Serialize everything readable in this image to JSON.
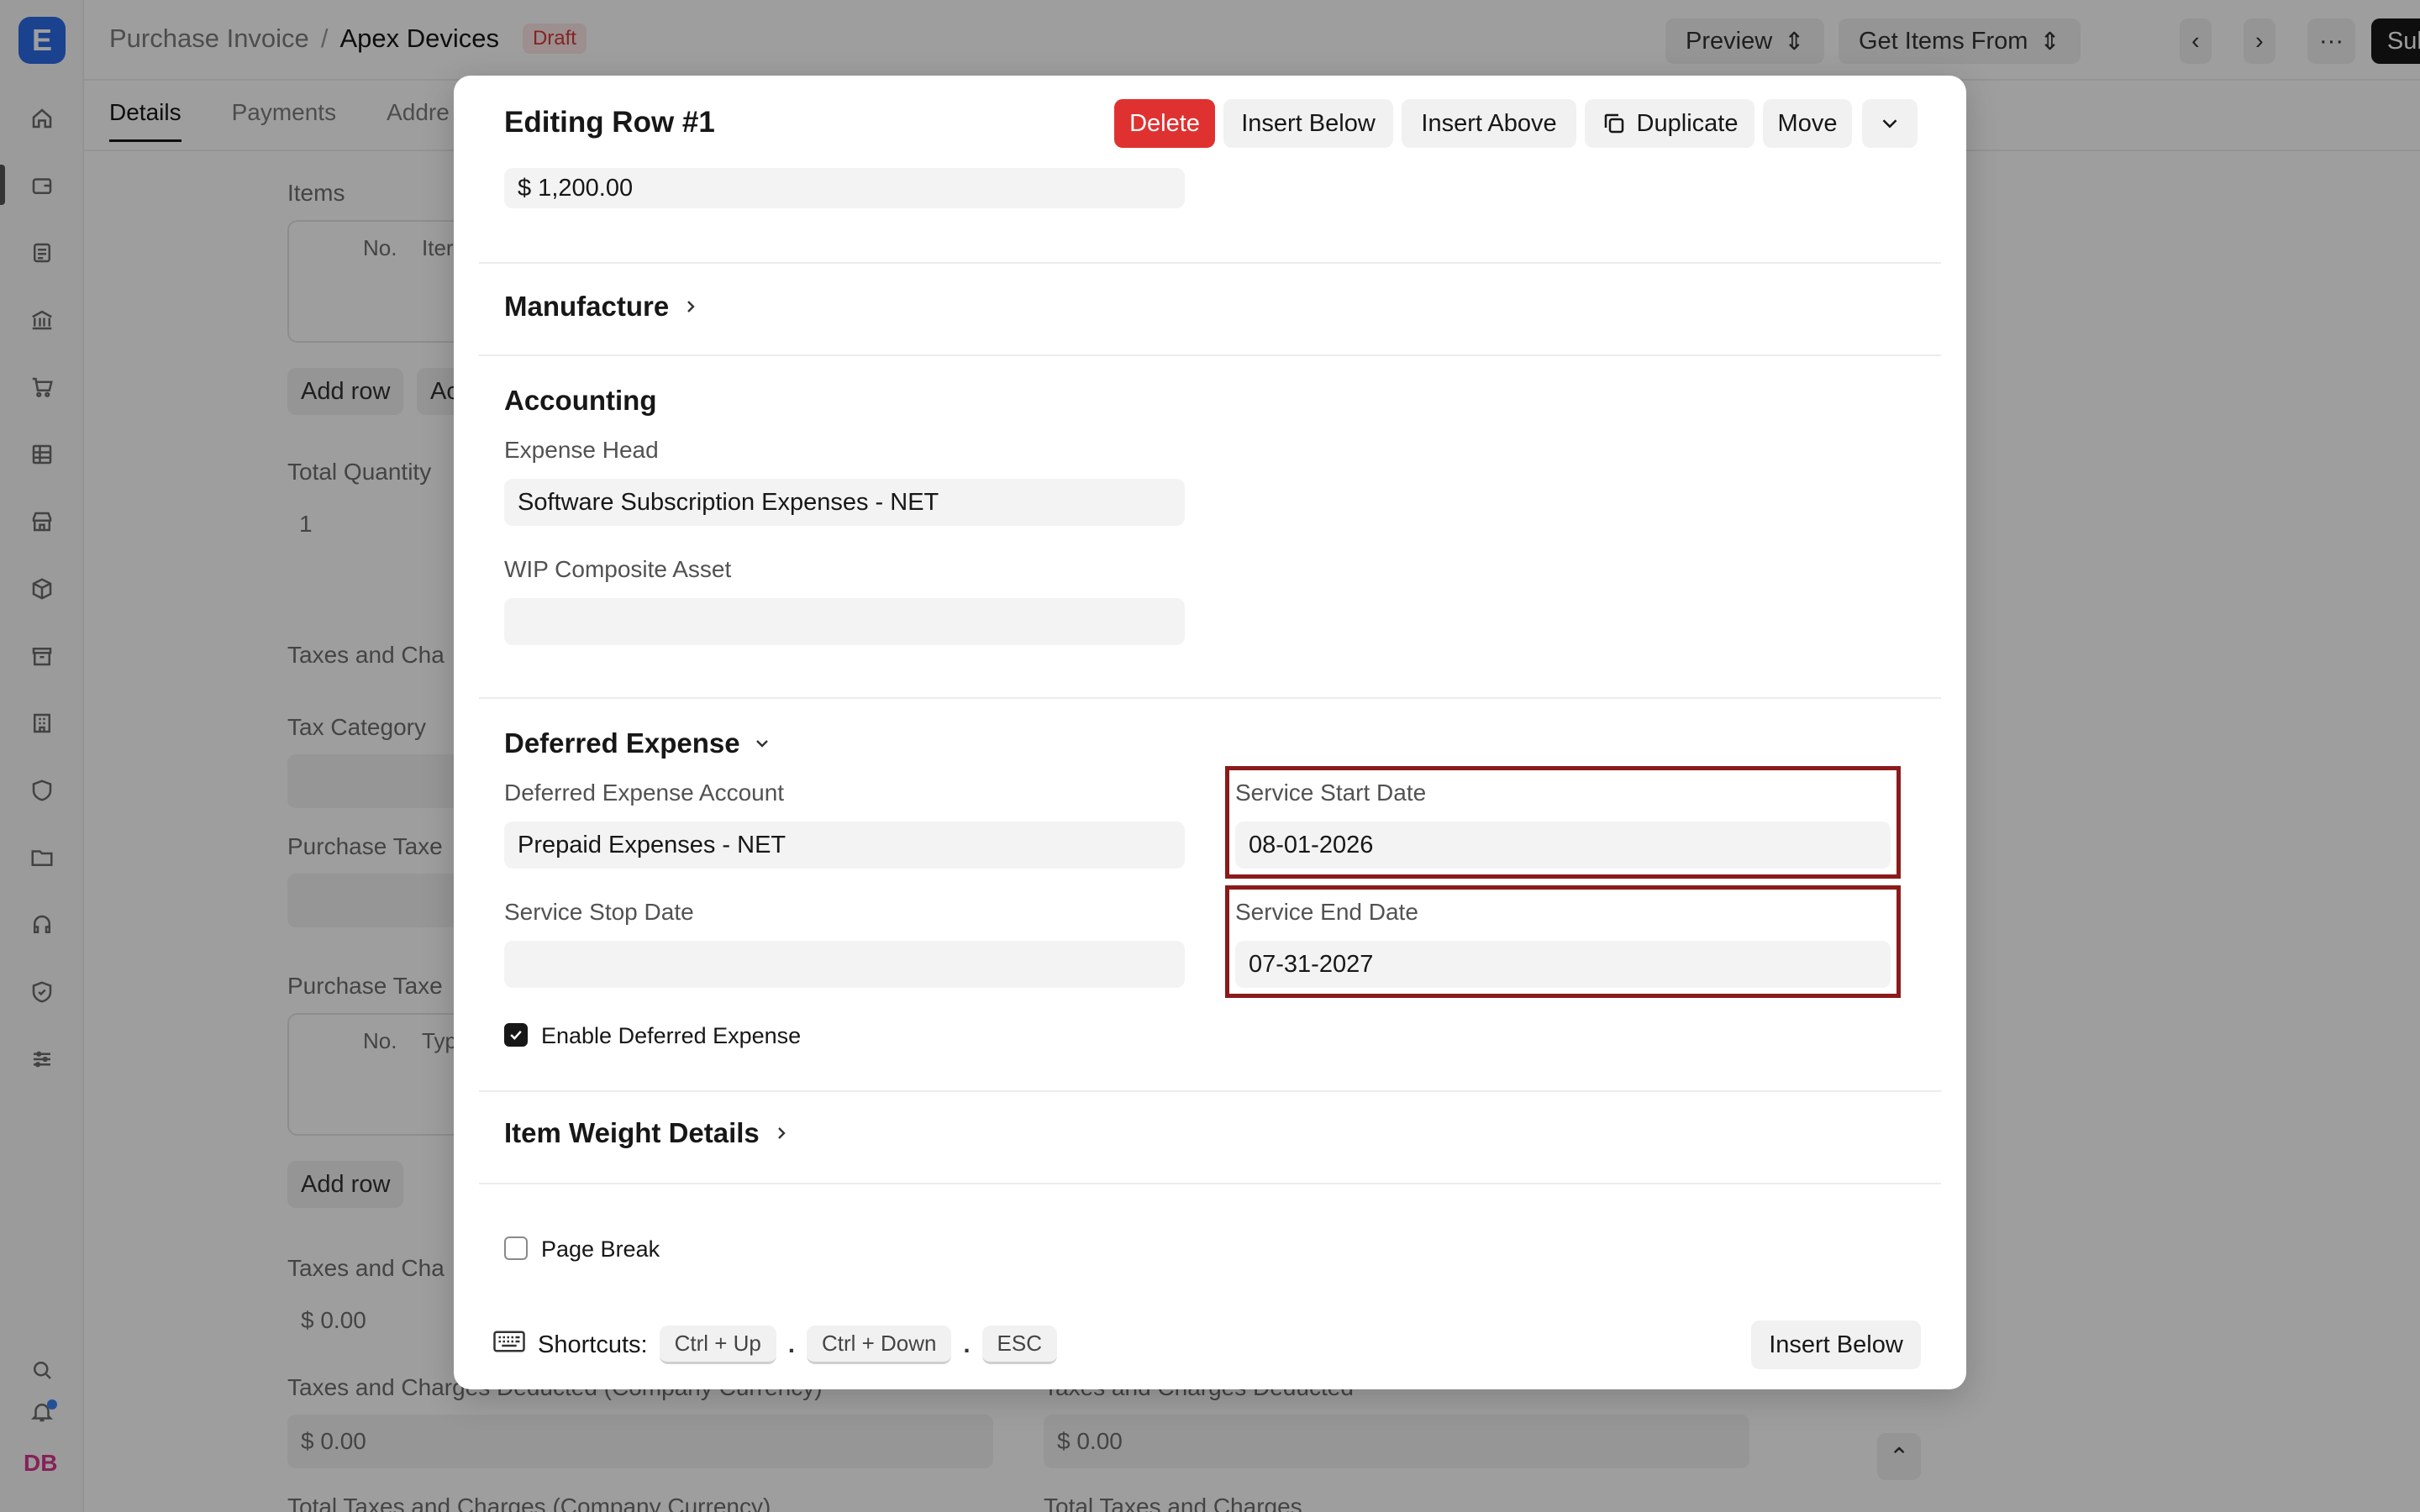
{
  "app": {
    "logo_letter": "E",
    "breadcrumb": {
      "parent": "Purchase Invoice",
      "separator": "/",
      "current": "Apex Devices",
      "status": "Draft"
    },
    "toolbar": {
      "preview": "Preview",
      "get_items": "Get Items From",
      "more": "···",
      "submit": "Submit"
    },
    "tabs": [
      "Details",
      "Payments",
      "Addre"
    ],
    "avatar_initials": "DB",
    "background": {
      "items_label": "Items",
      "no_col": "No.",
      "item_col": "Iter",
      "add_row": "Add row",
      "add_row_partial": "Ac",
      "total_quantity_label": "Total Quantity",
      "total_quantity_value": "1",
      "taxes_charges_label": "Taxes and Cha",
      "tax_category_label": "Tax Category",
      "purchase_taxes_label_1": "Purchase Taxe",
      "purchase_taxes_label_2": "Purchase Taxe",
      "type_col": "Typ",
      "add_row_2": "Add row",
      "taxes_charges_label_2": "Taxes and Cha",
      "taxes_value_1": "$ 0.00",
      "deducted_company_label": "Taxes and Charges Deducted (Company Currency)",
      "deducted_label": "Taxes and Charges Deducted",
      "deducted_company_value": "$ 0.00",
      "deducted_value": "$ 0.00",
      "total_taxes_company_label": "Total Taxes and Charges (Company Currency)",
      "total_taxes_label": "Total Taxes and Charges"
    }
  },
  "modal": {
    "title": "Editing Row #1",
    "buttons": {
      "delete": "Delete",
      "insert_below": "Insert Below",
      "insert_above": "Insert Above",
      "duplicate": "Duplicate",
      "move": "Move"
    },
    "amount_value": "$ 1,200.00",
    "manufacture_title": "Manufacture",
    "accounting": {
      "title": "Accounting",
      "expense_head_label": "Expense Head",
      "expense_head_value": "Software Subscription Expenses - NET",
      "wip_label": "WIP Composite Asset",
      "wip_value": ""
    },
    "deferred": {
      "title": "Deferred Expense",
      "account_label": "Deferred Expense Account",
      "account_value": "Prepaid Expenses - NET",
      "start_label": "Service Start Date",
      "start_value": "08-01-2026",
      "stop_label": "Service Stop Date",
      "stop_value": "",
      "end_label": "Service End Date",
      "end_value": "07-31-2027",
      "enable_label": "Enable Deferred Expense",
      "enable_checked": true
    },
    "item_weight_title": "Item Weight Details",
    "page_break_label": "Page Break",
    "footer": {
      "shortcuts_label": "Shortcuts:",
      "keys": [
        "Ctrl + Up",
        "Ctrl + Down",
        "ESC"
      ],
      "insert_below": "Insert Below"
    }
  }
}
